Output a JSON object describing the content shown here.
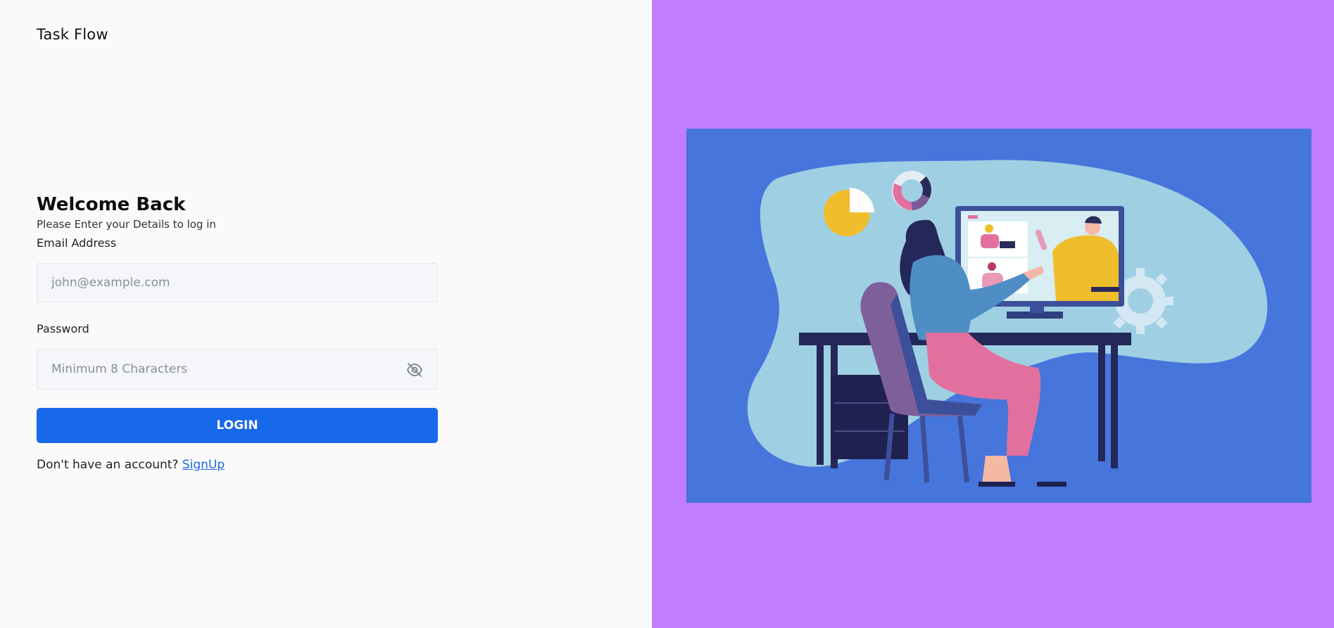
{
  "app": {
    "brand": "Task Flow"
  },
  "login": {
    "heading": "Welcome Back",
    "subtitle": "Please Enter your Details to log in",
    "email_label": "Email Address",
    "email_placeholder": "john@example.com",
    "password_label": "Password",
    "password_placeholder": "Minimum 8 Characters",
    "submit_label": "LOGIN",
    "signup_prompt": "Don't have an account?",
    "signup_link": "SignUp"
  },
  "icons": {
    "password_toggle": "eye-off-icon"
  },
  "colors": {
    "accent": "#1868ea",
    "panel": "#c17cff",
    "illustration_bg": "#4675dc"
  }
}
